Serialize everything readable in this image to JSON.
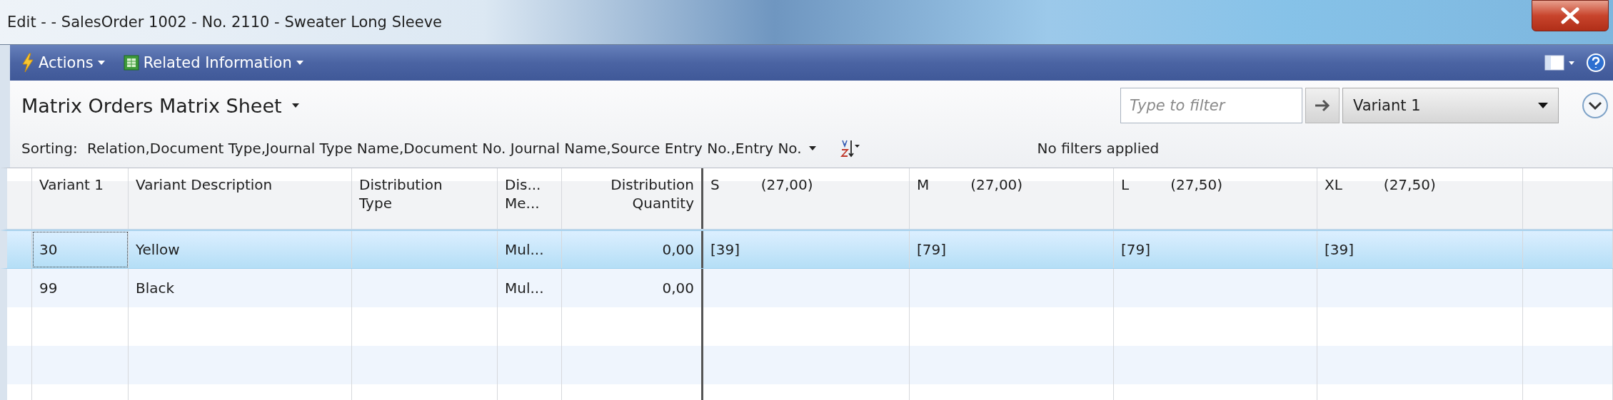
{
  "window": {
    "title": "Edit -  - SalesOrder 1002 - No. 2110 - Sweater Long Sleeve"
  },
  "action_bar": {
    "items": [
      {
        "label": "Actions",
        "kind": "actions"
      },
      {
        "label": "Related Information",
        "kind": "related"
      }
    ]
  },
  "page": {
    "title": "Matrix Orders Matrix Sheet",
    "sorting_label": "Sorting:",
    "sorting_value": "Relation,Document Type,Journal Type Name,Document No. Journal Name,Source Entry No.,Entry No.",
    "filter": {
      "placeholder": "Type to filter",
      "field": "Variant 1"
    },
    "filter_status": "No filters applied"
  },
  "table": {
    "columns": [
      {
        "lines": [
          "Variant 1"
        ]
      },
      {
        "lines": [
          "Variant Description"
        ]
      },
      {
        "lines": [
          "Distribution",
          "Type"
        ]
      },
      {
        "lines": [
          "Dis...",
          "Me..."
        ]
      },
      {
        "lines": [
          "Distribution",
          "Quantity"
        ]
      }
    ],
    "matrix_columns": [
      {
        "label": "S",
        "price": "(27,00)"
      },
      {
        "label": "M",
        "price": "(27,00)"
      },
      {
        "label": "L",
        "price": "(27,50)"
      },
      {
        "label": "XL",
        "price": "(27,50)"
      }
    ],
    "rows": [
      {
        "selected": true,
        "variant": "30",
        "description": "Yellow",
        "distribution_method": "Mul...",
        "quantity": "0,00",
        "matrix": [
          "[39]",
          "[79]",
          "[79]",
          "[39]"
        ]
      },
      {
        "selected": false,
        "variant": "99",
        "description": "Black",
        "distribution_method": "Mul...",
        "quantity": "0,00"
      }
    ]
  }
}
